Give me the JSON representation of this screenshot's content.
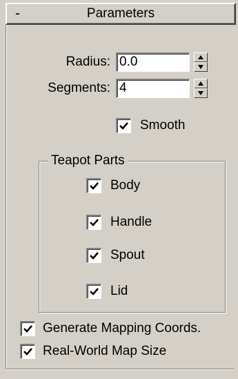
{
  "rollout": {
    "title": "Parameters",
    "collapse_symbol": "-"
  },
  "radius": {
    "label": "Radius:",
    "value": "0.0"
  },
  "segments": {
    "label": "Segments:",
    "value": "4"
  },
  "smooth": {
    "label": "Smooth",
    "checked": true
  },
  "teapot_parts": {
    "title": "Teapot Parts",
    "items": [
      {
        "label": "Body",
        "checked": true
      },
      {
        "label": "Handle",
        "checked": true
      },
      {
        "label": "Spout",
        "checked": true
      },
      {
        "label": "Lid",
        "checked": true
      }
    ]
  },
  "generate_mapping": {
    "label": "Generate Mapping Coords.",
    "checked": true
  },
  "real_world_map": {
    "label": "Real-World Map Size",
    "checked": true
  }
}
